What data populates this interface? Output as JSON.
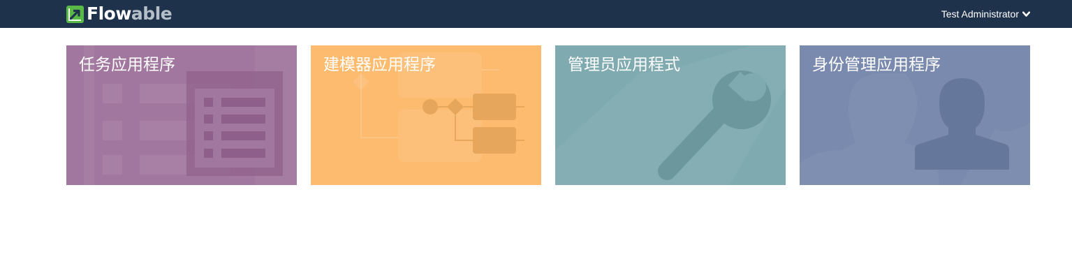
{
  "brand": {
    "name_part1": "Flow",
    "name_part2": "able",
    "logo_icon": "flowable-logo-icon",
    "nav_color": "#1f324b"
  },
  "user_menu": {
    "label": "Test Administrator",
    "icon": "chevron-down-icon"
  },
  "apps": [
    {
      "title": "任务应用程序",
      "icon": "task-list-icon",
      "color": "#a2779f"
    },
    {
      "title": "建模器应用程序",
      "icon": "process-diagram-icon",
      "color": "#fcbb6f"
    },
    {
      "title": "管理员应用程式",
      "icon": "wrench-icon",
      "color": "#7eaab0"
    },
    {
      "title": "身份管理应用程序",
      "icon": "user-silhouette-icon",
      "color": "#798aae"
    }
  ]
}
